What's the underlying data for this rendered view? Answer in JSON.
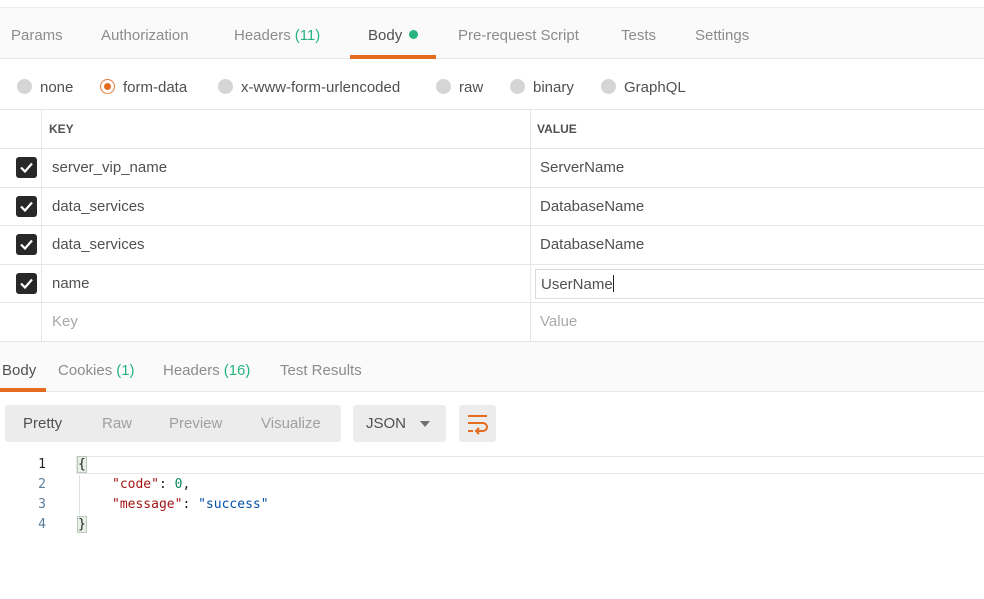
{
  "request_tabs": [
    {
      "label": "Params"
    },
    {
      "label": "Authorization"
    },
    {
      "label": "Headers",
      "count": "(11)"
    },
    {
      "label": "Body",
      "active": true
    },
    {
      "label": "Pre-request Script"
    },
    {
      "label": "Tests"
    },
    {
      "label": "Settings"
    }
  ],
  "body_types": [
    {
      "label": "none"
    },
    {
      "label": "form-data",
      "selected": true
    },
    {
      "label": "x-www-form-urlencoded"
    },
    {
      "label": "raw"
    },
    {
      "label": "binary"
    },
    {
      "label": "GraphQL"
    }
  ],
  "kv_table": {
    "key_header": "KEY",
    "value_header": "VALUE",
    "rows": [
      {
        "key": "server_vip_name",
        "value": "ServerName",
        "checked": true
      },
      {
        "key": "data_services",
        "value": "DatabaseName",
        "checked": true
      },
      {
        "key": "data_services",
        "value": "DatabaseName",
        "checked": true
      },
      {
        "key": "name",
        "value": "UserName",
        "checked": true,
        "editing": true
      }
    ],
    "new_row": {
      "key_placeholder": "Key",
      "value_placeholder": "Value"
    }
  },
  "response_tabs": [
    {
      "label": "Body",
      "active": true
    },
    {
      "label": "Cookies",
      "count": "(1)"
    },
    {
      "label": "Headers",
      "count": "(16)"
    },
    {
      "label": "Test Results"
    }
  ],
  "view_modes": [
    "Pretty",
    "Raw",
    "Preview",
    "Visualize"
  ],
  "active_view_mode": "Pretty",
  "format_select": {
    "value": "JSON",
    "icon": "chevron-down-icon"
  },
  "wrap_button": {
    "icon": "wrap-lines-icon"
  },
  "editor": {
    "line_numbers": [
      "1",
      "2",
      "3",
      "4"
    ],
    "open_brace": "{",
    "close_brace": "}",
    "entries": [
      {
        "key": "\"code\"",
        "value": "0",
        "value_type": "number",
        "trailing": ","
      },
      {
        "key": "\"message\"",
        "value": "\"success\"",
        "value_type": "string",
        "trailing": ""
      }
    ]
  },
  "colors": {
    "accent": "#e56b1f",
    "count_green": "#26b47f",
    "json_key": "#a31515",
    "json_number": "#098658",
    "json_string": "#0451a5"
  }
}
